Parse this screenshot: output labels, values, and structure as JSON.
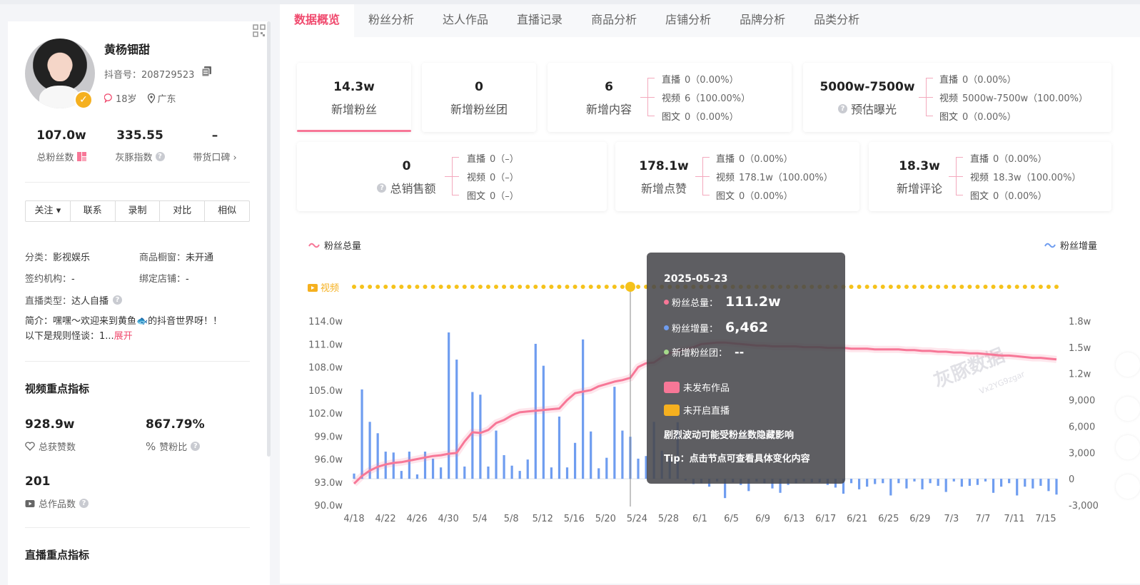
{
  "profile": {
    "name": "黄杨钿甜",
    "douyin_id": "抖音号：208729523",
    "age": "18岁",
    "location": "广东",
    "stats": [
      {
        "value": "107.0w",
        "label": "总粉丝数"
      },
      {
        "value": "335.55",
        "label": "灰豚指数"
      },
      {
        "value": "–",
        "label": "带货口碑 ›"
      }
    ],
    "actions": [
      "关注",
      "联系",
      "录制",
      "对比",
      "相似"
    ],
    "info": {
      "category_k": "分类：",
      "category_v": "影视娱乐",
      "window_k": "商品橱窗：",
      "window_v": "未开通",
      "agency_k": "签约机构：",
      "agency_v": "-",
      "shop_k": "绑定店铺：",
      "shop_v": "-",
      "live_type_k": "直播类型：",
      "live_type_v": "达人自播"
    },
    "intro": "简介：嘿嘿～欢迎来到黄鱼🐟的抖音世界呀！！ 以下是规则怪谈：1...",
    "intro_more": "展开",
    "video_section": {
      "title": "视频重点指标",
      "likes_value": "928.9w",
      "likes_label": "总获赞数",
      "ratio_value": "867.79%",
      "ratio_label": "赞粉比",
      "works_value": "201",
      "works_label": "总作品数"
    },
    "live_section_title": "直播重点指标"
  },
  "tabs": [
    "数据概览",
    "粉丝分析",
    "达人作品",
    "直播记录",
    "商品分析",
    "店铺分析",
    "品牌分析",
    "品类分析"
  ],
  "cards": {
    "new_fans": {
      "value": "14.3w",
      "label": "新增粉丝"
    },
    "new_fan_group": {
      "value": "0",
      "label": "新增粉丝团"
    },
    "new_content": {
      "value": "6",
      "label": "新增内容",
      "subs": [
        [
          "直播",
          "0（0.00%）"
        ],
        [
          "视频",
          "6（100.00%）"
        ],
        [
          "图文",
          "0（0.00%）"
        ]
      ]
    },
    "exposure": {
      "value": "5000w-7500w",
      "label": "预估曝光",
      "subs": [
        [
          "直播",
          "0（0.00%）"
        ],
        [
          "视频",
          "5000w-7500w（100.00%）"
        ],
        [
          "图文",
          "0（0.00%）"
        ]
      ]
    },
    "sales": {
      "value": "0",
      "label": "总销售额",
      "subs": [
        [
          "直播",
          "0（–）"
        ],
        [
          "视频",
          "0（–）"
        ],
        [
          "图文",
          "0（–）"
        ]
      ]
    },
    "likes": {
      "value": "178.1w",
      "label": "新增点赞",
      "subs": [
        [
          "直播",
          "0（0.00%）"
        ],
        [
          "视频",
          "178.1w（100.00%）"
        ],
        [
          "图文",
          "0（0.00%）"
        ]
      ]
    },
    "comments": {
      "value": "18.3w",
      "label": "新增评论",
      "subs": [
        [
          "直播",
          "0（0.00%）"
        ],
        [
          "视频",
          "18.3w（100.00%）"
        ],
        [
          "图文",
          "0（0.00%）"
        ]
      ]
    }
  },
  "chart_legend": {
    "left": "粉丝总量",
    "right": "粉丝增量",
    "video_row": "视频"
  },
  "watermark": {
    "main": "灰豚数据",
    "sub": "Vx2YG9zgar"
  },
  "tooltip": {
    "date": "2025-05-23",
    "total_label": "粉丝总量：",
    "total_value": "111.2w",
    "increase_label": "粉丝增量：",
    "increase_value": "6,462",
    "group_label": "新增粉丝团：",
    "group_value": "--",
    "no_works": "未发布作品",
    "no_live": "未开启直播",
    "warning": "剧烈波动可能受粉丝数隐藏影响",
    "tip": "Tip：点击节点可查看具体变化内容"
  },
  "colors": {
    "accent": "#f04a6e",
    "fans_line": "#f77797",
    "bars": "#6f9df0",
    "video_dots": "#f5c21b"
  },
  "chart_data": {
    "type": "line",
    "x_tick_labels": [
      "4/18",
      "4/22",
      "4/26",
      "4/30",
      "5/4",
      "5/8",
      "5/12",
      "5/16",
      "5/20",
      "5/24",
      "5/28",
      "6/1",
      "6/5",
      "6/9",
      "6/13",
      "6/17",
      "6/21",
      "6/25",
      "6/29",
      "7/3",
      "7/7",
      "7/11",
      "7/15"
    ],
    "left_ticks": [
      "114.0w",
      "111.0w",
      "108.0w",
      "105.0w",
      "102.0w",
      "99.0w",
      "96.0w",
      "93.0w",
      "90.0w"
    ],
    "right_ticks": [
      "1.8w",
      "1.5w",
      "1.2w",
      "9,000",
      "6,000",
      "3,000",
      "0",
      "-3,000"
    ],
    "left_ylim": [
      90.0,
      114.0
    ],
    "right_ylim": [
      -3000,
      18000
    ],
    "series": [
      {
        "name": "粉丝总量",
        "axis": "left",
        "unit": "w",
        "values": [
          92.8,
          93.8,
          94.5,
          95.0,
          95.3,
          95.5,
          95.6,
          95.8,
          96.0,
          96.2,
          96.4,
          96.5,
          96.7,
          96.8,
          98.3,
          99.5,
          99.4,
          99.8,
          100.7,
          101.1,
          101.7,
          102.1,
          102.2,
          102.3,
          102.4,
          102.5,
          102.6,
          103.7,
          104.6,
          104.8,
          105.0,
          105.5,
          105.8,
          106.1,
          106.3,
          106.6,
          108.0,
          108.5,
          108.6,
          109.3,
          109.8,
          110.1,
          110.3,
          110.6,
          111.0,
          111.1,
          111.2,
          111.2,
          111.1,
          111.0,
          110.9,
          110.8,
          110.8,
          110.7,
          110.7,
          110.7,
          110.7,
          110.6,
          110.6,
          110.6,
          110.5,
          110.5,
          110.5,
          110.4,
          110.4,
          110.4,
          110.3,
          110.3,
          110.3,
          110.3,
          110.2,
          110.2,
          110.1,
          110.1,
          110.0,
          110.0,
          109.9,
          109.9,
          109.8,
          109.8,
          109.7,
          109.6,
          109.5,
          109.5,
          109.4,
          109.3,
          109.2,
          109.2,
          109.1,
          109.0
        ]
      },
      {
        "name": "粉丝增量",
        "axis": "right",
        "values": [
          600,
          10200,
          6500,
          5200,
          3100,
          3000,
          900,
          3100,
          500,
          3100,
          2300,
          1300,
          16700,
          13600,
          1400,
          9900,
          9600,
          1400,
          5500,
          2700,
          1500,
          900,
          2200,
          15400,
          12900,
          1300,
          7100,
          1300,
          4100,
          15900,
          5400,
          1200,
          2400,
          10500,
          5500,
          4800,
          2300,
          2600,
          6500,
          3200,
          2400,
          6462,
          -200,
          -600,
          -500,
          -900,
          -300,
          -2200,
          -400,
          -700,
          -1400,
          -300,
          -500,
          -1100,
          -1600,
          -700,
          -500,
          -300,
          -400,
          -400,
          -700,
          -1000,
          -1700,
          -500,
          -1200,
          -900,
          -600,
          -500,
          -1900,
          -500,
          -1100,
          -300,
          -1200,
          -500,
          -800,
          -1500,
          -300,
          -900,
          -800,
          -700,
          -300,
          -1600,
          -900,
          -500,
          -1900,
          -900,
          -1100,
          -800,
          -1400,
          -1800
        ]
      }
    ],
    "video_row": "每日视频发布标记（橙色圆点）"
  }
}
